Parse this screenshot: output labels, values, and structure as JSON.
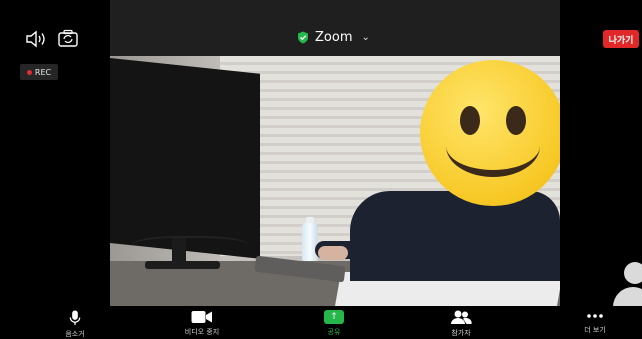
{
  "header": {
    "title": "Zoom",
    "title_icon": "shield-check-icon",
    "dropdown_icon": "chevron-down-icon",
    "speaker_icon": "speaker-icon",
    "camera_switch_icon": "camera-switch-icon",
    "leave_label": "나가기",
    "leave_color": "#e02828",
    "accent_green": "#25b74a"
  },
  "recording": {
    "label": "REC",
    "dot_color": "#e02e2e"
  },
  "video": {
    "participant_face_icon": "smiley-face-icon"
  },
  "side_participant": {
    "icon": "person-avatar-icon"
  },
  "toolbar": {
    "items": [
      {
        "icon": "microphone-icon",
        "label": "음소거"
      },
      {
        "icon": "video-camera-icon",
        "label": "비디오 중지"
      },
      {
        "icon": "share-screen-icon",
        "label": "공유"
      },
      {
        "icon": "participants-icon",
        "label": "참가자"
      },
      {
        "icon": "more-icon",
        "label": "더 보기"
      }
    ]
  }
}
